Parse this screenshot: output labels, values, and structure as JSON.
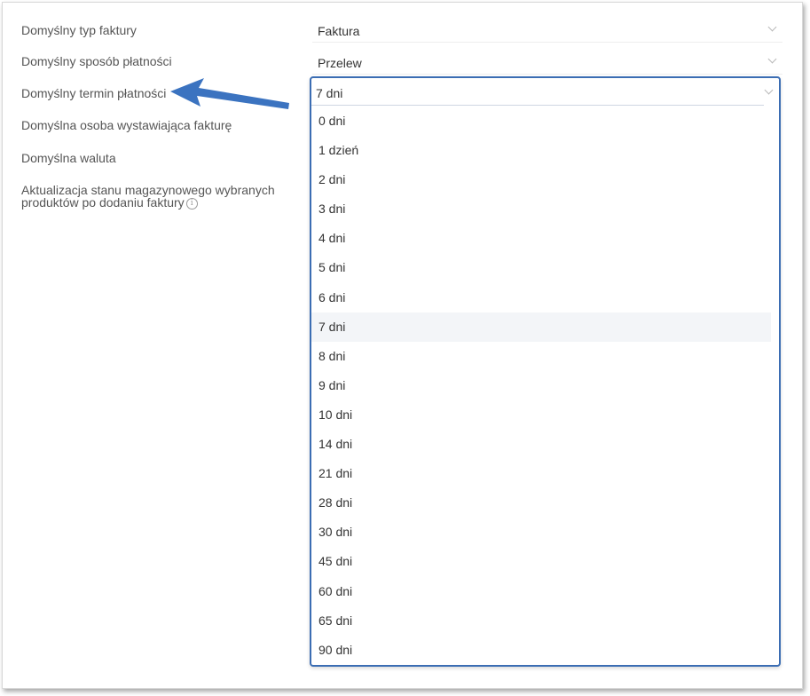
{
  "settings": {
    "rows": [
      {
        "label": "Domyślny typ faktury",
        "value": "Faktura"
      },
      {
        "label": "Domyślny sposób płatności",
        "value": "Przelew"
      },
      {
        "label": "Domyślny termin płatności",
        "value": "7 dni"
      },
      {
        "label": "Domyślna osoba wystawiająca fakturę"
      },
      {
        "label": "Domyślna waluta"
      },
      {
        "label": "Aktualizacja stanu magazynowego wybranych produktów po dodaniu faktury",
        "info_icon": "info-circle-icon"
      }
    ]
  },
  "dropdown": {
    "selected": "7 dni",
    "options": [
      "0 dni",
      "1 dzień",
      "2 dni",
      "3 dni",
      "4 dni",
      "5 dni",
      "6 dni",
      "7 dni",
      "8 dni",
      "9 dni",
      "10 dni",
      "14 dni",
      "21 dni",
      "28 dni",
      "30 dni",
      "45 dni",
      "60 dni",
      "65 dni",
      "90 dni"
    ]
  },
  "annotation": {
    "arrow_icon": "pointer-arrow-icon",
    "arrow_color": "#3b73c0"
  },
  "colors": {
    "accent": "#3b6db3",
    "label_text": "#555555",
    "selected_option_bg": "#f3f5f8"
  }
}
